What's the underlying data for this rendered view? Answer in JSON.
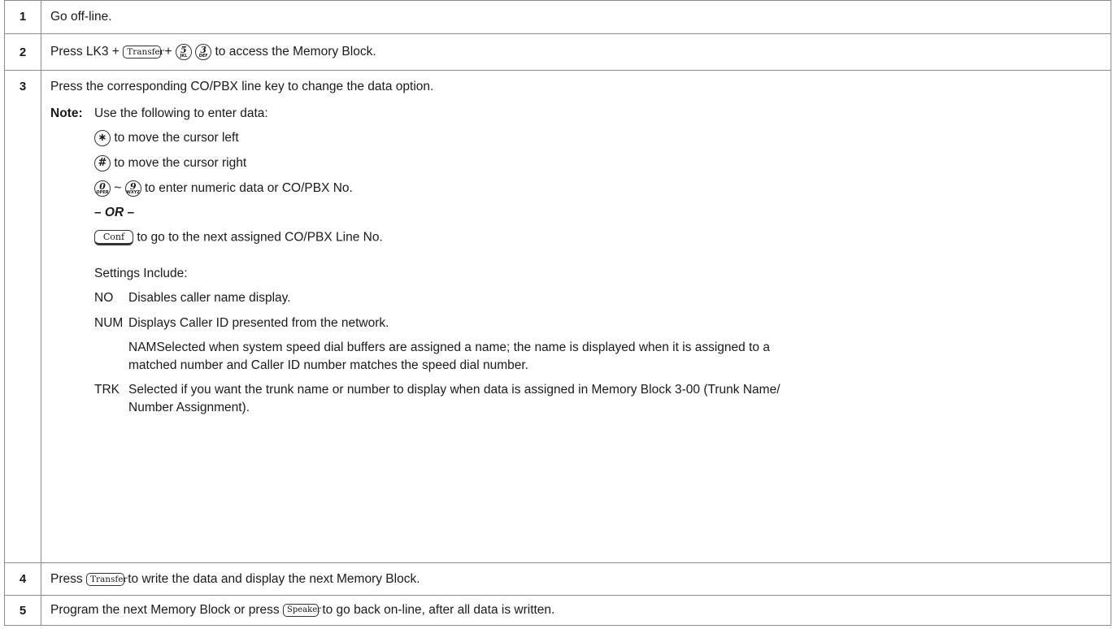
{
  "steps": [
    {
      "num": "1",
      "text": "Go off-line."
    },
    {
      "num": "2",
      "text_before": "Press LK3 +",
      "plus1": "+",
      "text_after": "to access the Memory Block."
    },
    {
      "num": "3",
      "text": "Press the corresponding CO/PBX line key to change the data option."
    },
    {
      "num": "4",
      "text_before": "Press",
      "text_after": "to write the data and display the next Memory Block."
    },
    {
      "num": "5",
      "text_before": "Program the next Memory Block or press",
      "text_after": "to go back on-line, after all data is written."
    }
  ],
  "note": {
    "label": "Note:",
    "intro": "Use the following to enter data:",
    "star_text": "to move the cursor left",
    "pound_text": "to move the cursor right",
    "tilde": "~",
    "range_text": "to enter numeric data or CO/PBX No.",
    "or": "– OR –",
    "conf_text": "to go to the next assigned CO/PBX Line No.",
    "settings_label": "Settings Include:",
    "settings": [
      {
        "code": "NO",
        "text": "Disables caller name display."
      },
      {
        "code": "NUM",
        "text": "Displays Caller ID presented from the network."
      },
      {
        "code": "NAM",
        "text_line1": "Selected when system speed dial buffers are assigned a name; the name is displayed when it is assigned to a",
        "text_line2": "matched number and Caller ID number matches the speed dial number."
      },
      {
        "code": "TRK",
        "text_line1": "Selected if you want the trunk name or number to display when data is assigned in Memory Block 3-00 (Trunk Name/",
        "text_line2": "Number Assignment)."
      }
    ]
  },
  "keys": {
    "transfer": "Transfer",
    "speaker": "Speaker",
    "conf": "Conf",
    "k5_digit": "5",
    "k5_letters": "JKL",
    "k3_digit": "3",
    "k3_letters": "DEF",
    "k0_digit": "0",
    "k0_letters": "OPER",
    "k9_digit": "9",
    "k9_letters": "WXYZ",
    "star": "∗",
    "pound": "#"
  }
}
